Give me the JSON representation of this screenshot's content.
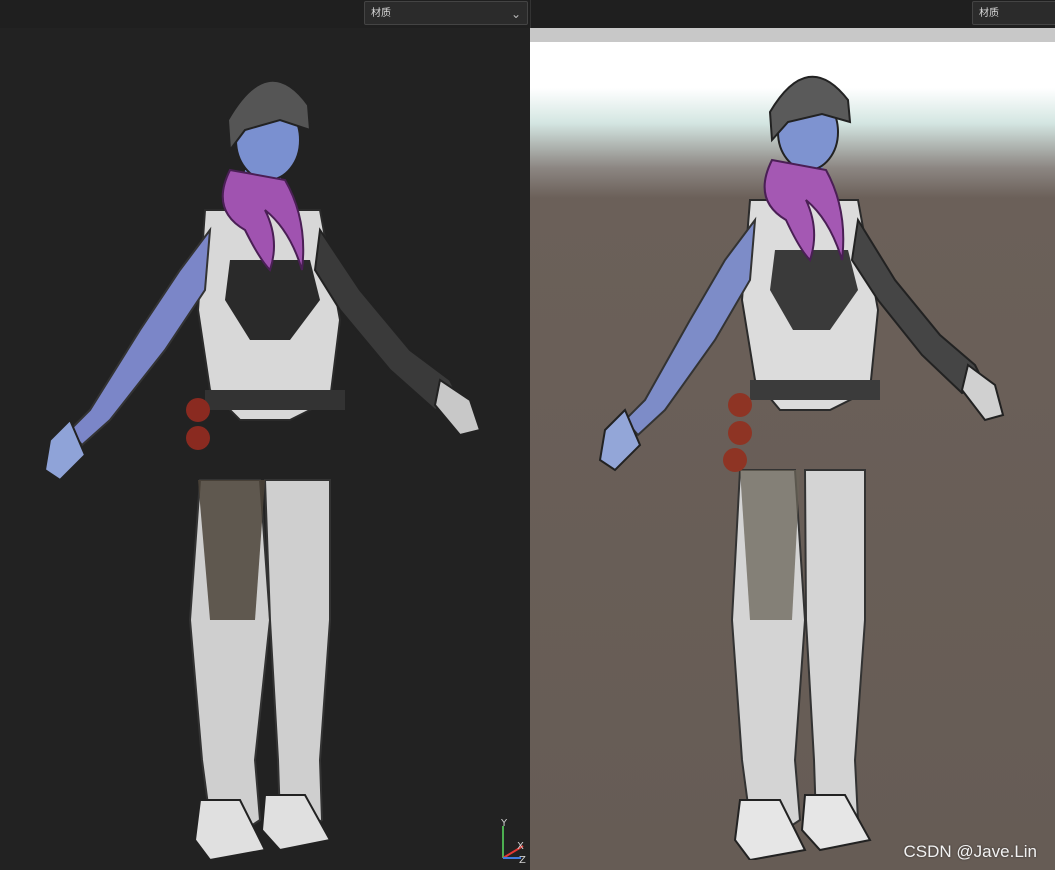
{
  "left_panel": {
    "dropdown": {
      "value": "材质"
    }
  },
  "right_panel": {
    "dropdown": {
      "value": "材质"
    }
  },
  "gizmo": {
    "y_label": "Y",
    "x_label": "X",
    "z_label": "Z"
  },
  "watermark": "CSDN @Jave.Lin",
  "colors": {
    "left_background": "#222222",
    "right_sky": "#ffffff",
    "right_ground": "#665c55",
    "skin": "#7f95cf",
    "hair": "#9a4fa8",
    "armor_white": "#d9d9d9",
    "armor_dark": "#2e2e2e"
  }
}
